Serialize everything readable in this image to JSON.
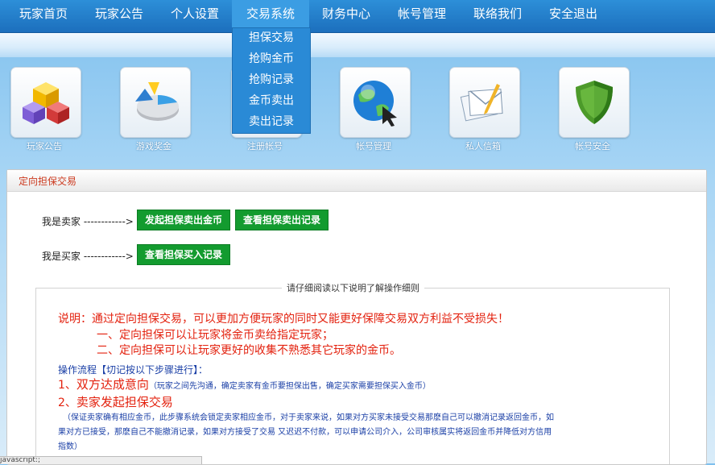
{
  "nav": {
    "items": [
      "玩家首页",
      "玩家公告",
      "个人设置",
      "交易系统",
      "财务中心",
      "帐号管理",
      "联络我们",
      "安全退出"
    ],
    "active": "交易系统"
  },
  "dropdown": [
    "担保交易",
    "抢购金币",
    "抢购记录",
    "金币卖出",
    "卖出记录"
  ],
  "tiles": [
    {
      "label": "玩家公告",
      "icon": "cubes-icon"
    },
    {
      "label": "游戏奖金",
      "icon": "pie-chart-icon"
    },
    {
      "label": "注册帐号",
      "icon": "register-icon"
    },
    {
      "label": "帐号管理",
      "icon": "globe-cursor-icon"
    },
    {
      "label": "私人信箱",
      "icon": "mail-icon"
    },
    {
      "label": "帐号安全",
      "icon": "shield-icon"
    }
  ],
  "panel": {
    "title": "定向担保交易",
    "seller_label": "我是卖家 ------------>",
    "buyer_label": "我是买家 ------------>",
    "btn_sell": "发起担保卖出金币",
    "btn_sell_records": "查看担保卖出记录",
    "btn_buy_records": "查看担保买入记录",
    "legend": "请仔细阅读以下说明了解操作细则",
    "desc": "说明：通过定向担保交易，可以更加方便玩家的同时又能更好保障交易双方利益不受损失！",
    "point1": "一、定向担保可以让玩家将金币卖给指定玩家；",
    "point2": "二、定向担保可以让玩家更好的收集不熟悉其它玩家的金币。",
    "flow_title": "操作流程【切记按以下步骤进行】：",
    "step1_num": "1、",
    "step1_title": "双方达成意向",
    "step1_note": "（玩家之间先沟通，确定卖家有金币要担保出售，确定买家需要担保买入金币）",
    "step2_num": "2、",
    "step2_title": "卖家发起担保交易",
    "step2_line1": "（保证卖家确有相应金币，此步骤系统会锁定卖家相应金币，对于卖家来说，如果对方买家未接受交易那麽自己可以撤消记录返回金币，如",
    "step2_line2": "果对方已接受，那麽自己不能撤消记录，如果对方接受了交易 又迟迟不付款，可以申请公司介入，公司审核属实将返回金币并降低对方信用",
    "step2_line3": "指数）"
  },
  "statusbar": "javascript:;"
}
